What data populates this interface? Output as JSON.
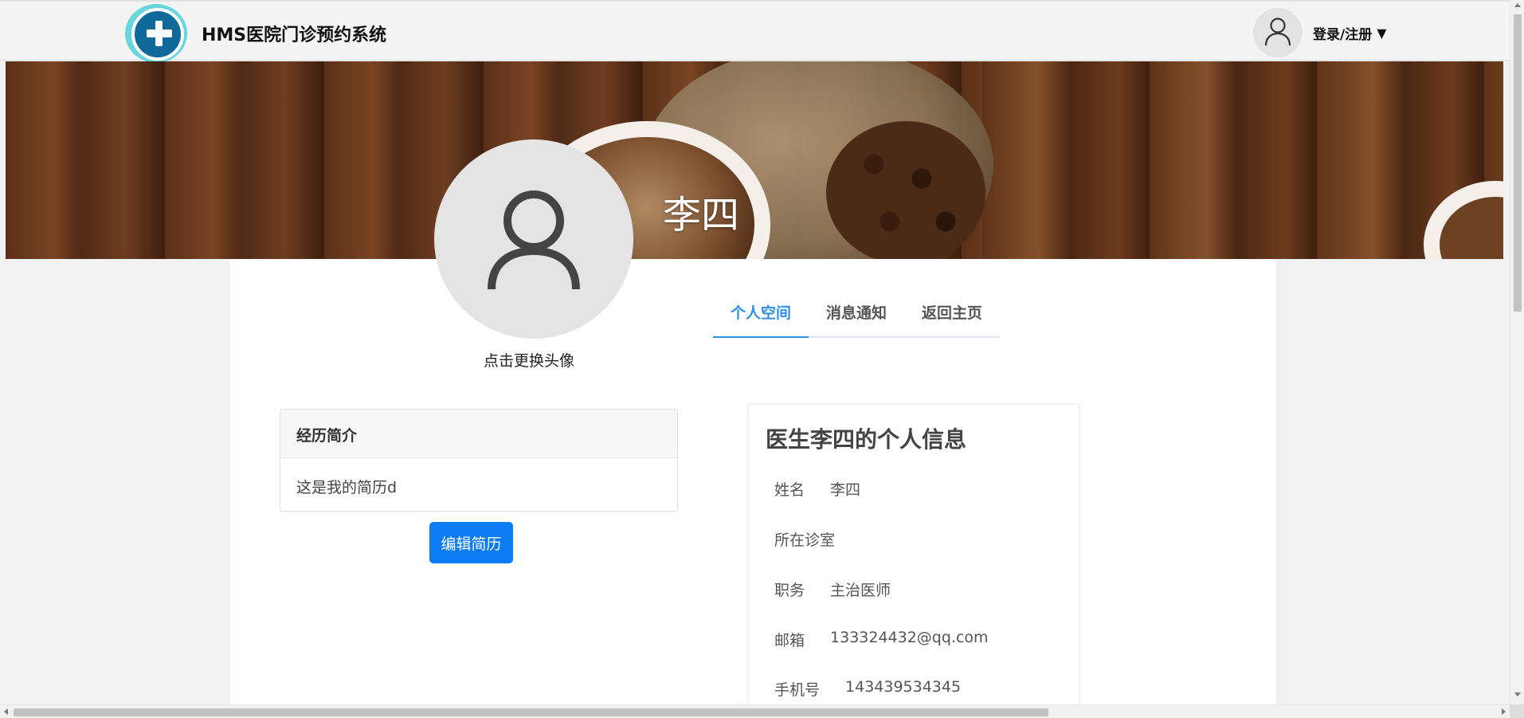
{
  "header": {
    "app_title": "HMS医院门诊预约系统",
    "logo_icon": "medical-cross-icon",
    "user_icon": "user-icon",
    "login_label": "登录/注册",
    "caret": "▼"
  },
  "banner": {
    "doctor_name": "李四"
  },
  "profile": {
    "avatar_icon": "user-icon",
    "avatar_caption": "点击更换头像"
  },
  "tabs": [
    {
      "label": "个人空间",
      "active": true
    },
    {
      "label": "消息通知",
      "active": false
    },
    {
      "label": "返回主页",
      "active": false
    }
  ],
  "resume": {
    "header": "经历简介",
    "body": "这是我的简历d",
    "edit_button": "编辑简历"
  },
  "info": {
    "title": "医生李四的个人信息",
    "rows": [
      {
        "label": "姓名",
        "value": "李四"
      },
      {
        "label": "所在诊室",
        "value": ""
      },
      {
        "label": "职务",
        "value": "主治医师"
      },
      {
        "label": "邮箱",
        "value": "133324432@qq.com"
      },
      {
        "label": "手机号",
        "value": "143439534345"
      }
    ]
  },
  "colors": {
    "accent": "#2f8fe6",
    "primary_button": "#0c7cf2",
    "logo_teal": "#68d6dc",
    "logo_blue": "#0f6a9a"
  }
}
